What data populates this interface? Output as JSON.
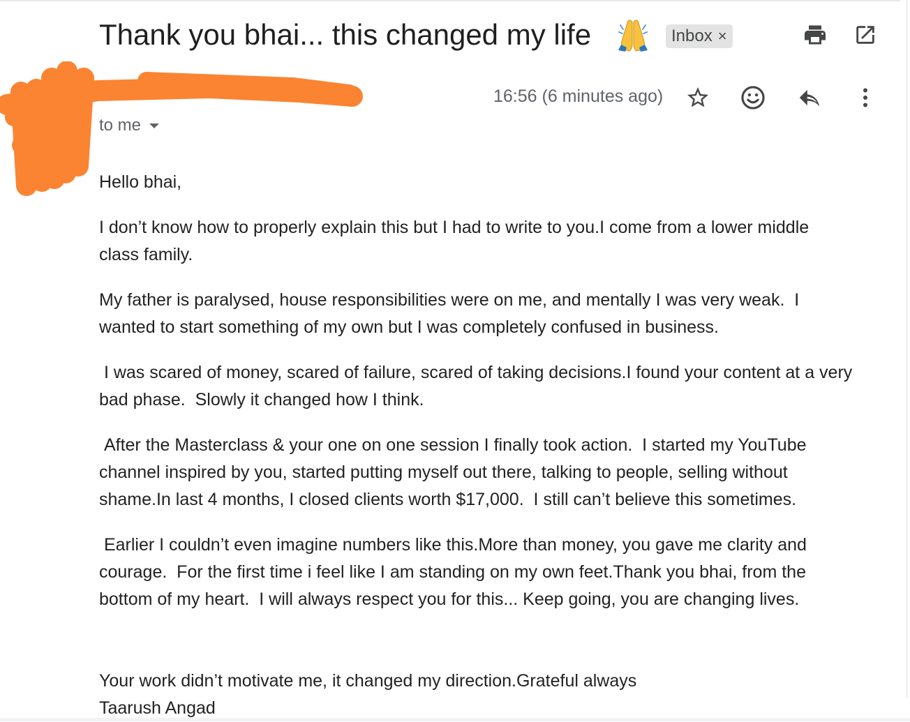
{
  "email": {
    "subject": "Thank you bhai... this changed my life",
    "subject_emoji": "folded-hands-emoji",
    "label": "Inbox",
    "label_remove": "×",
    "timestamp": "16:56 (6 minutes ago)",
    "recipient": "to me"
  },
  "icons": {
    "print": "print-icon",
    "open_new_window": "open-in-new-window-icon",
    "star": "star-icon",
    "emoji_reaction": "emoji-reaction-icon",
    "reply": "reply-icon",
    "more": "more-options-icon",
    "caret": "chevron-down-icon"
  },
  "colors": {
    "redaction": "#fb8432",
    "badge_bg": "#e2e3e2",
    "secondary_text": "#5f6368"
  },
  "body": {
    "greeting": "Hello bhai,",
    "paragraphs": [
      "I don’t know how to properly explain this but I had to write to you.I come from a lower middle class family.",
      "My father is paralysed, house responsibilities were on me, and mentally I was very weak.  I wanted to start something of my own but I was completely confused in business.",
      " I was scared of money, scared of failure, scared of taking decisions.I found your content at a very bad phase.  Slowly it changed how I think.",
      " After the Masterclass & your one on one session I finally took action.  I started my YouTube channel inspired by you, started putting myself out there, talking to people, selling without shame.In last 4 months, I closed clients worth $17,000.  I still can’t believe this sometimes.",
      " Earlier I couldn’t even imagine numbers like this.More than money, you gave me clarity and courage.  For the first time i feel like I am standing on my own feet.Thank you bhai, from the bottom of my heart.  I will always respect you for this... Keep going, you are changing lives."
    ],
    "closing": "Your work didn’t motivate me, it changed my direction.Grateful always",
    "signature": "Taarush Angad"
  }
}
